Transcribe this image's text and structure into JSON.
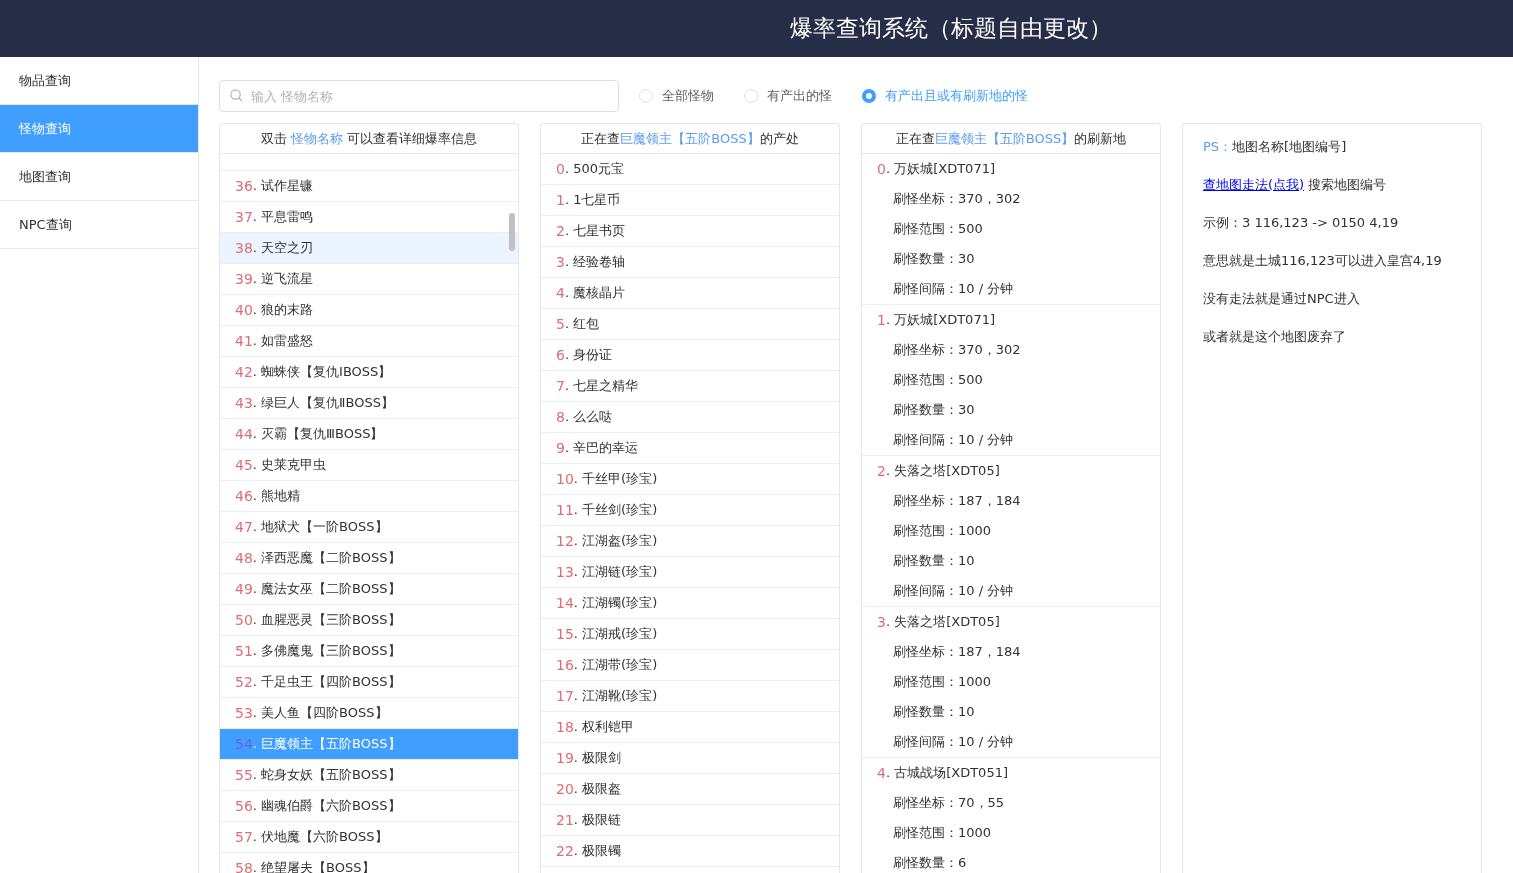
{
  "header": {
    "title": "爆率查询系统（标题自由更改）"
  },
  "sidebar": {
    "items": [
      {
        "label": "物品查询",
        "selected": false
      },
      {
        "label": "怪物查询",
        "selected": true
      },
      {
        "label": "地图查询",
        "selected": false
      },
      {
        "label": "NPC查询",
        "selected": false
      }
    ]
  },
  "search": {
    "placeholder": "输入 怪物名称"
  },
  "filters": [
    {
      "label": "全部怪物",
      "selected": false
    },
    {
      "label": "有产出的怪",
      "selected": false
    },
    {
      "label": "有产出且或有刷新地的怪",
      "selected": true
    }
  ],
  "monster_list": {
    "hint": {
      "before": "双击 ",
      "highlight": "怪物名称",
      "after": " 可以查看详细爆率信息"
    },
    "rows": [
      {
        "number": "36",
        "text": ". 试作星镰",
        "selected": false,
        "hovered": false
      },
      {
        "number": "37",
        "text": ". 平息雷鸣",
        "selected": false,
        "hovered": false
      },
      {
        "number": "38",
        "text": ". 天空之刃",
        "selected": false,
        "hovered": true
      },
      {
        "number": "39",
        "text": ". 逆飞流星",
        "selected": false,
        "hovered": false
      },
      {
        "number": "40",
        "text": ". 狼的末路",
        "selected": false,
        "hovered": false
      },
      {
        "number": "41",
        "text": ". 如雷盛怒",
        "selected": false,
        "hovered": false
      },
      {
        "number": "42",
        "text": ". 蜘蛛侠【复仇ⅠBOSS】",
        "selected": false,
        "hovered": false
      },
      {
        "number": "43",
        "text": ". 绿巨人【复仇ⅡBOSS】",
        "selected": false,
        "hovered": false
      },
      {
        "number": "44",
        "text": ". 灭霸【复仇ⅢBOSS】",
        "selected": false,
        "hovered": false
      },
      {
        "number": "45",
        "text": ". 史莱克甲虫",
        "selected": false,
        "hovered": false
      },
      {
        "number": "46",
        "text": ". 熊地精",
        "selected": false,
        "hovered": false
      },
      {
        "number": "47",
        "text": ". 地狱犬【一阶BOSS】",
        "selected": false,
        "hovered": false
      },
      {
        "number": "48",
        "text": ". 泽西恶魔【二阶BOSS】",
        "selected": false,
        "hovered": false
      },
      {
        "number": "49",
        "text": ". 魔法女巫【二阶BOSS】",
        "selected": false,
        "hovered": false
      },
      {
        "number": "50",
        "text": ". 血腥恶灵【三阶BOSS】",
        "selected": false,
        "hovered": false
      },
      {
        "number": "51",
        "text": ". 多佛魔鬼【三阶BOSS】",
        "selected": false,
        "hovered": false
      },
      {
        "number": "52",
        "text": ". 千足虫王【四阶BOSS】",
        "selected": false,
        "hovered": false
      },
      {
        "number": "53",
        "text": ". 美人鱼【四阶BOSS】",
        "selected": false,
        "hovered": false
      },
      {
        "number": "54",
        "text": ". 巨魔领主【五阶BOSS】",
        "selected": true,
        "hovered": false
      },
      {
        "number": "55",
        "text": ". 蛇身女妖【五阶BOSS】",
        "selected": false,
        "hovered": false
      },
      {
        "number": "56",
        "text": ". 幽魂伯爵【六阶BOSS】",
        "selected": false,
        "hovered": false
      },
      {
        "number": "57",
        "text": ". 伏地魔【六阶BOSS】",
        "selected": false,
        "hovered": false
      },
      {
        "number": "58",
        "text": ". 绝望屠夫【BOSS】",
        "selected": false,
        "hovered": false
      }
    ]
  },
  "drops": {
    "heading": {
      "before": "正在查",
      "highlight": "巨魔领主【五阶BOSS】",
      "after": "的产处"
    },
    "rows": [
      {
        "number": "0",
        "text": ". 500元宝"
      },
      {
        "number": "1",
        "text": ". 1七星币"
      },
      {
        "number": "2",
        "text": ". 七星书页"
      },
      {
        "number": "3",
        "text": ". 经验卷轴"
      },
      {
        "number": "4",
        "text": ". 魔核晶片"
      },
      {
        "number": "5",
        "text": ". 红包"
      },
      {
        "number": "6",
        "text": ". 身份证"
      },
      {
        "number": "7",
        "text": ". 七星之精华"
      },
      {
        "number": "8",
        "text": ". 么么哒"
      },
      {
        "number": "9",
        "text": ". 辛巴的幸运"
      },
      {
        "number": "10",
        "text": ". 千丝甲(珍宝)"
      },
      {
        "number": "11",
        "text": ". 千丝剑(珍宝)"
      },
      {
        "number": "12",
        "text": ". 江湖盔(珍宝)"
      },
      {
        "number": "13",
        "text": ". 江湖链(珍宝)"
      },
      {
        "number": "14",
        "text": ". 江湖镯(珍宝)"
      },
      {
        "number": "15",
        "text": ". 江湖戒(珍宝)"
      },
      {
        "number": "16",
        "text": ". 江湖带(珍宝)"
      },
      {
        "number": "17",
        "text": ". 江湖靴(珍宝)"
      },
      {
        "number": "18",
        "text": ". 权利铠甲"
      },
      {
        "number": "19",
        "text": ". 极限剑"
      },
      {
        "number": "20",
        "text": ". 极限盔"
      },
      {
        "number": "21",
        "text": ". 极限链"
      },
      {
        "number": "22",
        "text": ". 极限镯"
      }
    ]
  },
  "spawns": {
    "heading": {
      "before": "正在查",
      "highlight": "巨魔领主【五阶BOSS】",
      "after": "的刷新地"
    },
    "entries": [
      {
        "number": "0",
        "map": ". 万妖城[XDT071]",
        "details": [
          "刷怪坐标：370，302",
          "刷怪范围：500",
          "刷怪数量：30",
          "刷怪间隔：10 / 分钟"
        ]
      },
      {
        "number": "1",
        "map": ". 万妖城[XDT071]",
        "details": [
          "刷怪坐标：370，302",
          "刷怪范围：500",
          "刷怪数量：30",
          "刷怪间隔：10 / 分钟"
        ]
      },
      {
        "number": "2",
        "map": ". 失落之塔[XDT05]",
        "details": [
          "刷怪坐标：187，184",
          "刷怪范围：1000",
          "刷怪数量：10",
          "刷怪间隔：10 / 分钟"
        ]
      },
      {
        "number": "3",
        "map": ". 失落之塔[XDT05]",
        "details": [
          "刷怪坐标：187，184",
          "刷怪范围：1000",
          "刷怪数量：10",
          "刷怪间隔：10 / 分钟"
        ]
      },
      {
        "number": "4",
        "map": ". 古城战场[XDT051]",
        "details": [
          "刷怪坐标：70，55",
          "刷怪范围：1000",
          "刷怪数量：6"
        ]
      }
    ]
  },
  "notes": {
    "lines": [
      {
        "kind": "ps",
        "prefix": "PS：",
        "text": "地图名称[地图编号]"
      },
      {
        "kind": "link",
        "link": "查地图走法(点我)",
        "text": " 搜索地图编号"
      },
      {
        "kind": "plain",
        "text": "示例：3 116,123 -> 0150 4,19"
      },
      {
        "kind": "plain",
        "text": "意思就是土城116,123可以进入皇宫4,19"
      },
      {
        "kind": "plain",
        "text": "没有走法就是通过NPC进入"
      },
      {
        "kind": "plain",
        "text": "或者就是这个地图废弃了"
      }
    ]
  }
}
